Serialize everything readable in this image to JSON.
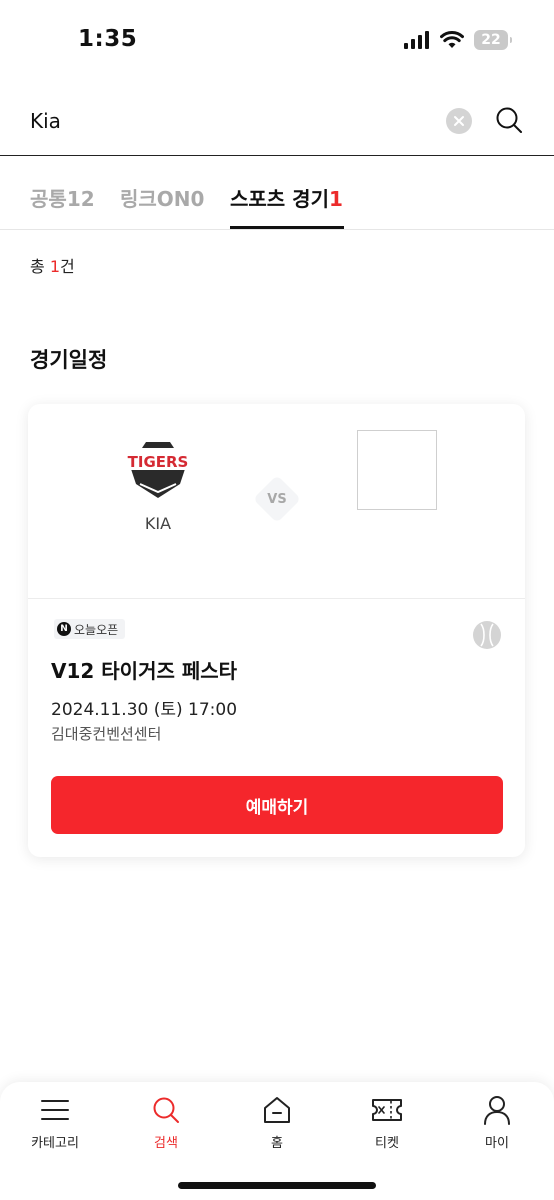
{
  "status_bar": {
    "time": "1:35",
    "battery": "22"
  },
  "search": {
    "query": "Kia"
  },
  "tabs": [
    {
      "label": "공통",
      "count": "12"
    },
    {
      "label": "링크ON",
      "count": "0"
    },
    {
      "label": "스포츠 경기",
      "count": "1"
    }
  ],
  "results": {
    "prefix": "총 ",
    "count": "1",
    "suffix": "건"
  },
  "section_title": "경기일정",
  "event": {
    "home_team": "KIA",
    "home_logo_text": "TIGERS",
    "vs": "VS",
    "badge_n": "N",
    "badge": "오늘오픈",
    "title": "V12 타이거즈 페스타",
    "datetime": "2024.11.30 (토) 17:00",
    "venue": "김대중컨벤션센터",
    "book_label": "예매하기"
  },
  "bottom_nav": [
    {
      "label": "카테고리",
      "icon": "menu-icon"
    },
    {
      "label": "검색",
      "icon": "search-icon"
    },
    {
      "label": "홈",
      "icon": "home-icon"
    },
    {
      "label": "티켓",
      "icon": "ticket-icon"
    },
    {
      "label": "마이",
      "icon": "user-icon"
    }
  ],
  "colors": {
    "accent": "#f5262c",
    "count_red": "#ec2b2b",
    "tigers_red": "#d52a33"
  }
}
